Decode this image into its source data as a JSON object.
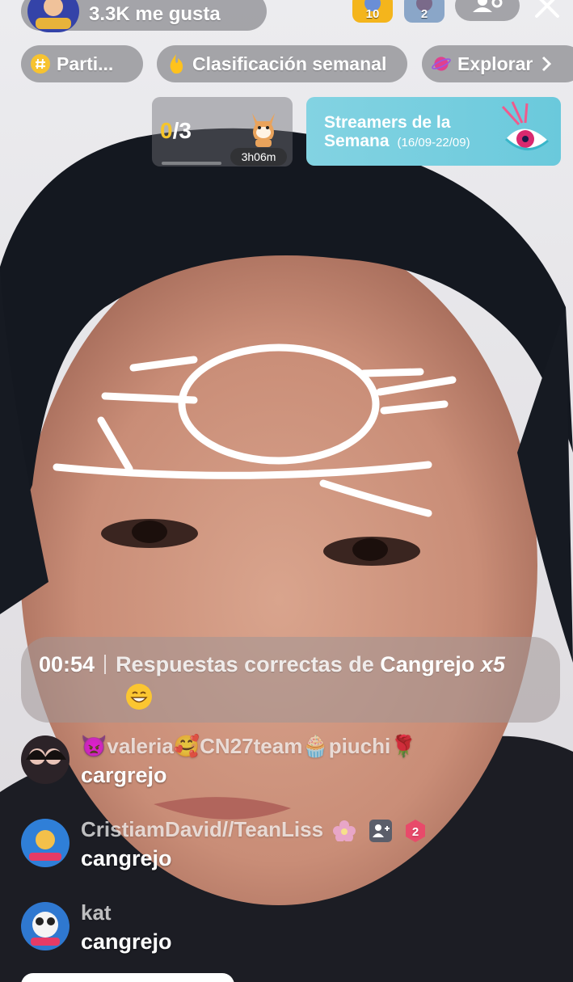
{
  "header": {
    "likes_text": "3.3K me gusta",
    "rank_badges": [
      {
        "number": "10",
        "color": "#f4b51c"
      },
      {
        "number": "2",
        "color": "#8aa6c8"
      }
    ]
  },
  "chips": [
    {
      "label": "Parti...",
      "icon": "hashtag-icon",
      "color": "#f7c330"
    },
    {
      "label": "Clasificación semanal",
      "icon": "flame-icon",
      "color": "#ffc21d"
    },
    {
      "label": "Explorar",
      "icon": "planet-icon",
      "color": "#e0418e"
    }
  ],
  "task_card": {
    "completed": "0",
    "total": "/3",
    "progress": 0.0,
    "timer": "3h06m"
  },
  "streamers_banner": {
    "title_line1": "Streamers de la",
    "title_line2": "Semana",
    "dates": "(16/09-22/09)"
  },
  "announcement": {
    "time": "00:54",
    "prefix": "Respuestas correctas de",
    "keyword": "Cangrejo",
    "multiplier": "x5",
    "emoji": "grinning-face-icon"
  },
  "comments": [
    {
      "user": "👿valeria🥰CN27team🧁piuchi🌹",
      "message": "cargrejo"
    },
    {
      "user": "CristiamDavid//TeanLiss",
      "message": "cangrejo",
      "level": "2"
    },
    {
      "user": "kat",
      "message": "cangrejo"
    }
  ],
  "colors": {
    "accent_yellow": "#f5c52b",
    "banner_blue": "#76cfe0"
  }
}
